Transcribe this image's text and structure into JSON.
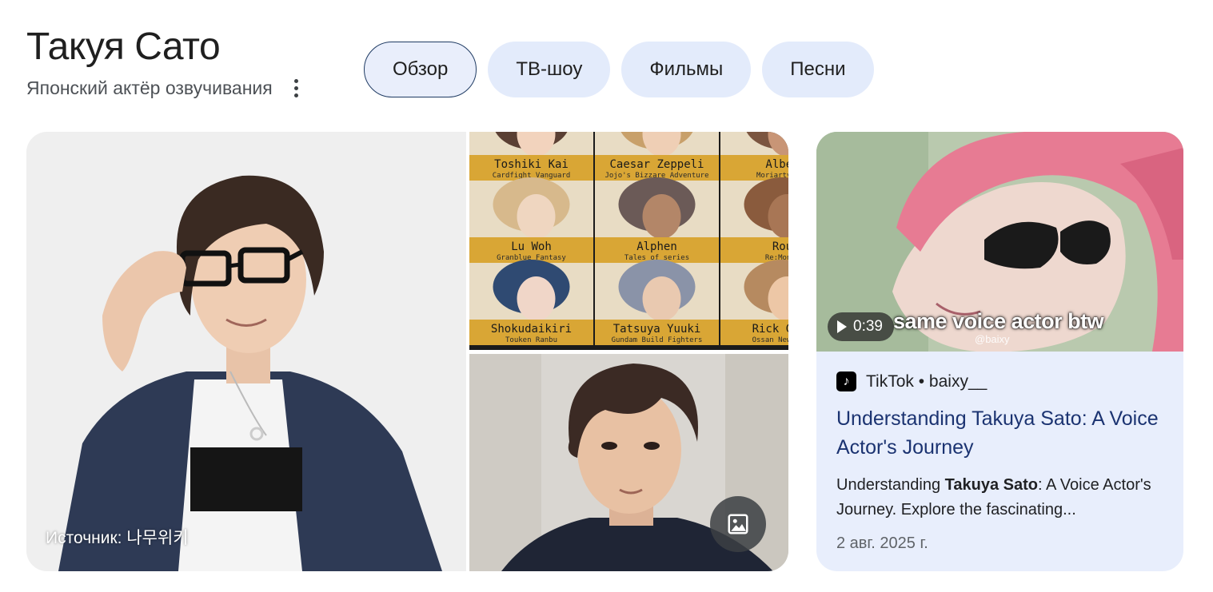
{
  "header": {
    "title": "Такуя Сато",
    "subtitle": "Японский актёр озвучивания"
  },
  "tabs": [
    {
      "label": "Обзор",
      "active": true
    },
    {
      "label": "ТВ-шоу",
      "active": false
    },
    {
      "label": "Фильмы",
      "active": false
    },
    {
      "label": "Песни",
      "active": false
    }
  ],
  "images": {
    "source_label": "Источник: 나무위키",
    "collage": [
      {
        "name": "Toshiki Kai",
        "series": "Cardfight Vanguard"
      },
      {
        "name": "Caesar Zeppeli",
        "series": "Jojo's Bizzare Adventure"
      },
      {
        "name": "Alber",
        "series": "Moriarty the"
      },
      {
        "name": "Lu Woh",
        "series": "Granblue Fantasy"
      },
      {
        "name": "Alphen",
        "series": "Tales of series"
      },
      {
        "name": "Rou",
        "series": "Re:Monst"
      },
      {
        "name": "Shokudaikiri",
        "series": "Touken Ranbu"
      },
      {
        "name": "Tatsuya Yuuki",
        "series": "Gundam Build Fighters"
      },
      {
        "name": "Rick Glac",
        "series": "Ossan Newbie A"
      }
    ]
  },
  "video": {
    "duration": "0:39",
    "thumb_caption": "same voice actor btw",
    "thumb_watermark": "@baixy",
    "source": "TikTok • baixy__",
    "title": "Understanding Takuya Sato: A Voice Actor's Journey",
    "snippet_pre": "Understanding ",
    "snippet_bold": "Takuya Sato",
    "snippet_post": ": A Voice Actor's Journey. Explore the fascinating...",
    "date": "2 авг. 2025 г."
  }
}
